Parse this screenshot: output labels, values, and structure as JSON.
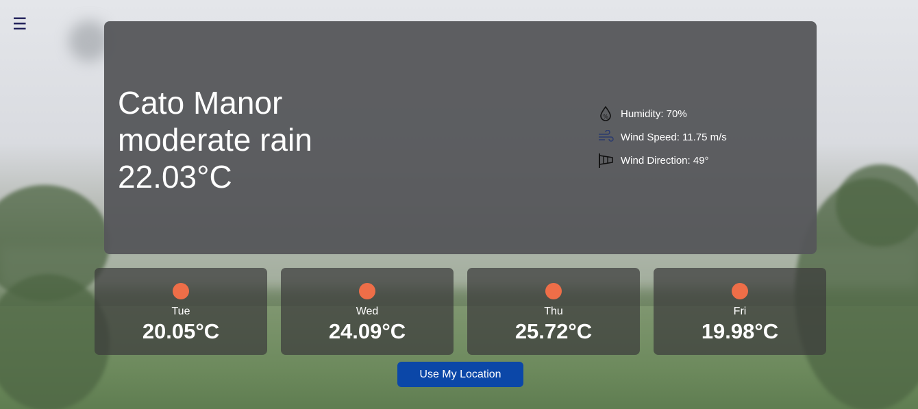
{
  "menu": {
    "icon": "hamburger-menu-icon",
    "glyph": "☰"
  },
  "current": {
    "city": "Cato Manor",
    "description": "moderate rain",
    "temperature": "22.03°C"
  },
  "details": {
    "humidity": "Humidity: 70%",
    "wind_speed": "Wind Speed: 11.75 m/s",
    "wind_direction": "Wind Direction: 49°"
  },
  "forecast": [
    {
      "day": "Tue",
      "temp": "20.05°C",
      "icon": "sun-icon"
    },
    {
      "day": "Wed",
      "temp": "24.09°C",
      "icon": "sun-icon"
    },
    {
      "day": "Thu",
      "temp": "25.72°C",
      "icon": "sun-icon"
    },
    {
      "day": "Fri",
      "temp": "19.98°C",
      "icon": "sun-icon"
    }
  ],
  "actions": {
    "use_location": "Use My Location"
  },
  "colors": {
    "sun": "#ee6e48",
    "button": "#0b47a8",
    "card": "#55565a"
  }
}
